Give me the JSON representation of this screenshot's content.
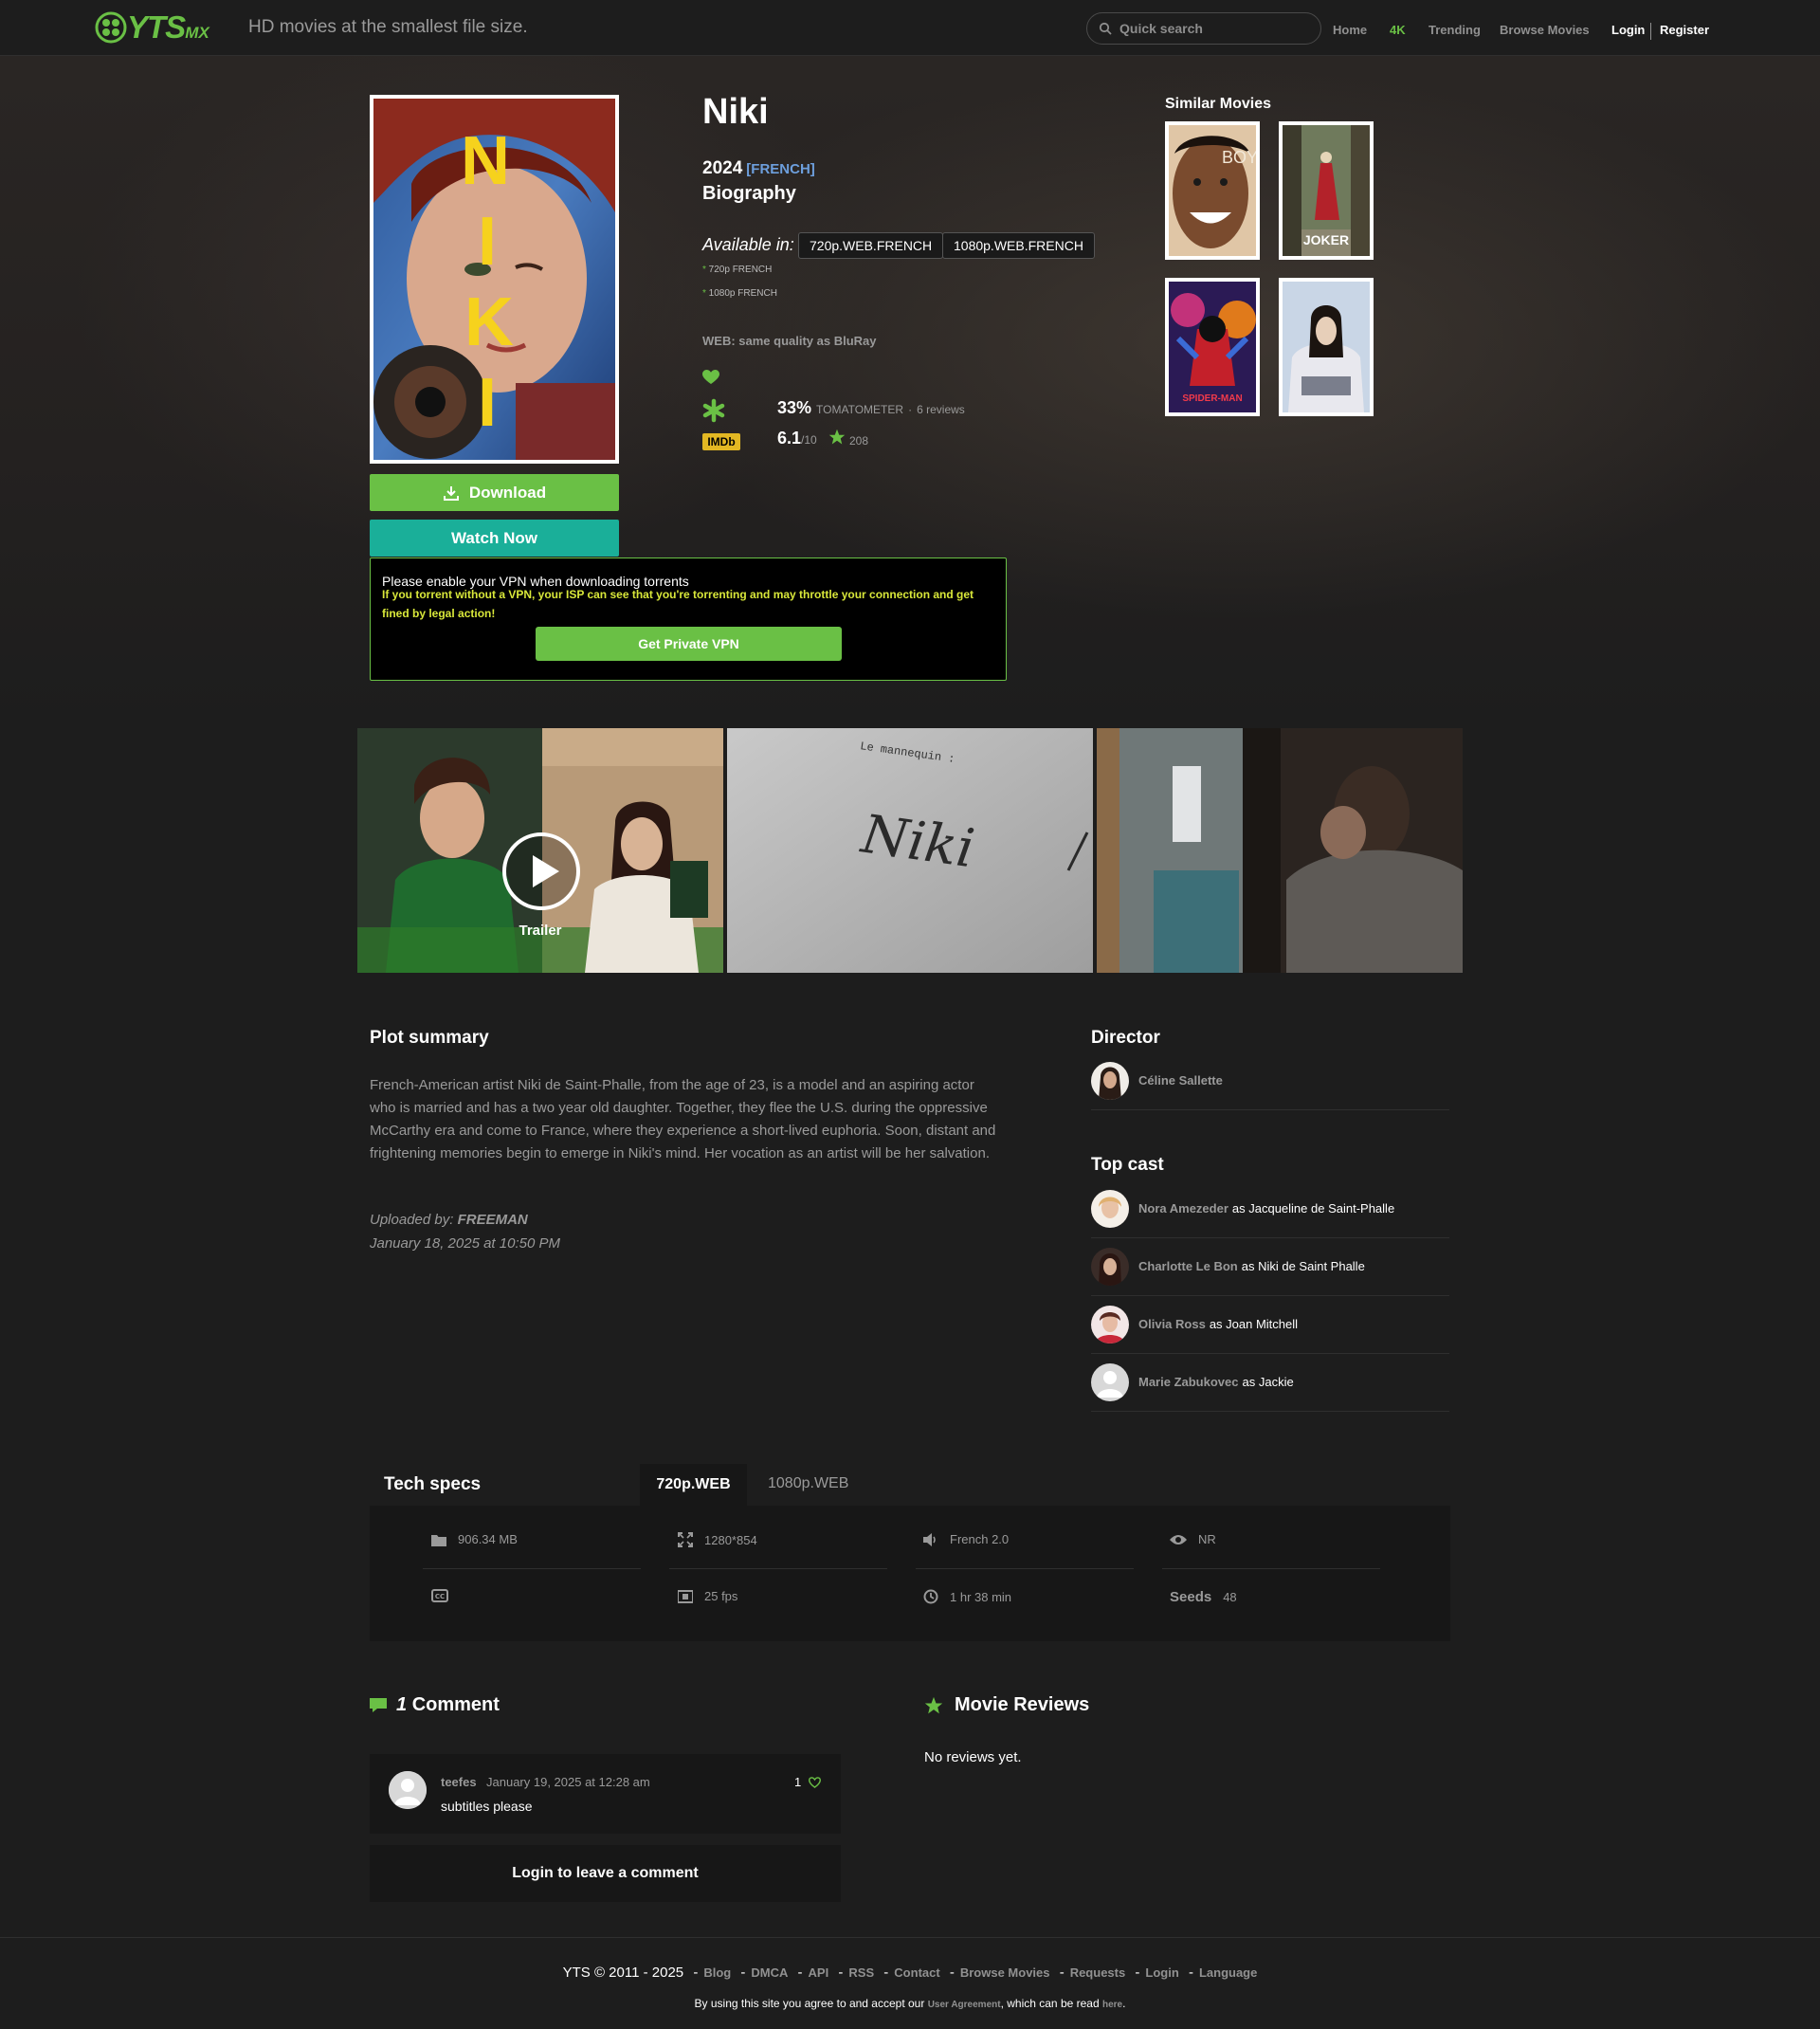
{
  "header": {
    "logo_text": "YTS",
    "logo_suffix": "MX",
    "tagline": "HD movies at the smallest file size.",
    "search_placeholder": "Quick search",
    "nav": {
      "home": "Home",
      "k4": "4K",
      "trending": "Trending",
      "browse": "Browse Movies",
      "login": "Login",
      "register": "Register"
    }
  },
  "movie": {
    "title": "Niki",
    "year": "2024",
    "language": "[FRENCH]",
    "genre": "Biography",
    "available_label": "Available in:",
    "qualities": [
      "720p.WEB.FRENCH",
      "1080p.WEB.FRENCH"
    ],
    "quality_notes": [
      "720p FRENCH",
      "1080p FRENCH"
    ],
    "web_note": "WEB: same quality as BluRay",
    "tomatometer": {
      "score": "33%",
      "label": "TOMATOMETER",
      "reviews": "6 reviews"
    },
    "imdb": {
      "badge": "IMDb",
      "score": "6.1",
      "out_of": "/10",
      "votes": "208"
    },
    "poster_letters": [
      "N",
      "I",
      "K",
      "I"
    ]
  },
  "buttons": {
    "download": "Download",
    "watch_now": "Watch Now"
  },
  "vpn": {
    "title": "Please enable your VPN when downloading torrents",
    "warning": "If you torrent without a VPN, your ISP can see that you're torrenting and may throttle your connection and get fined by legal action!",
    "button": "Get Private VPN"
  },
  "similar": {
    "title": "Similar Movies",
    "poster_texts": [
      "BOY",
      "JOKER",
      "SPIDER-MAN",
      ""
    ]
  },
  "screenshots": {
    "trailer_label": "Trailer",
    "handwriting": "Niki",
    "typed": "Le mannequin :"
  },
  "plot": {
    "heading": "Plot summary",
    "text": "French-American artist Niki de Saint-Phalle, from the age of 23, is a model and an aspiring actor who is married and has a two year old daughter. Together, they flee the U.S. during the oppressive McCarthy era and come to France, where they experience a short-lived euphoria. Soon, distant and frightening memories begin to emerge in Niki's mind. Her vocation as an artist will be her salvation.",
    "uploaded_label": "Uploaded by:",
    "uploader": "FREEMAN",
    "uploaded_date": "January 18, 2025 at 10:50 PM"
  },
  "director": {
    "heading": "Director",
    "name": "Céline Sallette"
  },
  "cast": {
    "heading": "Top cast",
    "members": [
      {
        "name": "Nora Amezeder",
        "role": "as Jacqueline de Saint-Phalle"
      },
      {
        "name": "Charlotte Le Bon",
        "role": "as Niki de Saint Phalle"
      },
      {
        "name": "Olivia Ross",
        "role": "as Joan Mitchell"
      },
      {
        "name": "Marie Zabukovec",
        "role": "as Jackie"
      }
    ]
  },
  "tech": {
    "heading": "Tech specs",
    "tabs": [
      "720p.WEB",
      "1080p.WEB"
    ],
    "size": "906.34 MB",
    "resolution": "1280*854",
    "audio": "French 2.0",
    "rating": "NR",
    "subtitles": "",
    "fps": "25 fps",
    "runtime": "1 hr 38 min",
    "seeds_label": "Seeds",
    "seeds": "48"
  },
  "comments": {
    "count": "1",
    "heading": "Comment",
    "items": [
      {
        "user": "teefes",
        "date": "January 19, 2025 at 12:28 am",
        "text": "subtitles please",
        "likes": "1"
      }
    ],
    "login_prompt": "Login to leave a comment"
  },
  "reviews": {
    "heading": "Movie Reviews",
    "empty": "No reviews yet."
  },
  "footer": {
    "copyright": "YTS © 2011 - 2025",
    "links": [
      "Blog",
      "DMCA",
      "API",
      "RSS",
      "Contact",
      "Browse Movies",
      "Requests",
      "Login",
      "Language"
    ],
    "note_prefix": "By using this site you agree to and accept our",
    "note_link": "User Agreement",
    "note_mid": ", which can be read",
    "note_here": "here"
  },
  "colors": {
    "accent_green": "#6ac045",
    "watch_teal": "#1aaf99",
    "background": "#1d1d1d",
    "imdb_yellow": "#e3b823",
    "vpn_warning": "#d9e83a"
  }
}
